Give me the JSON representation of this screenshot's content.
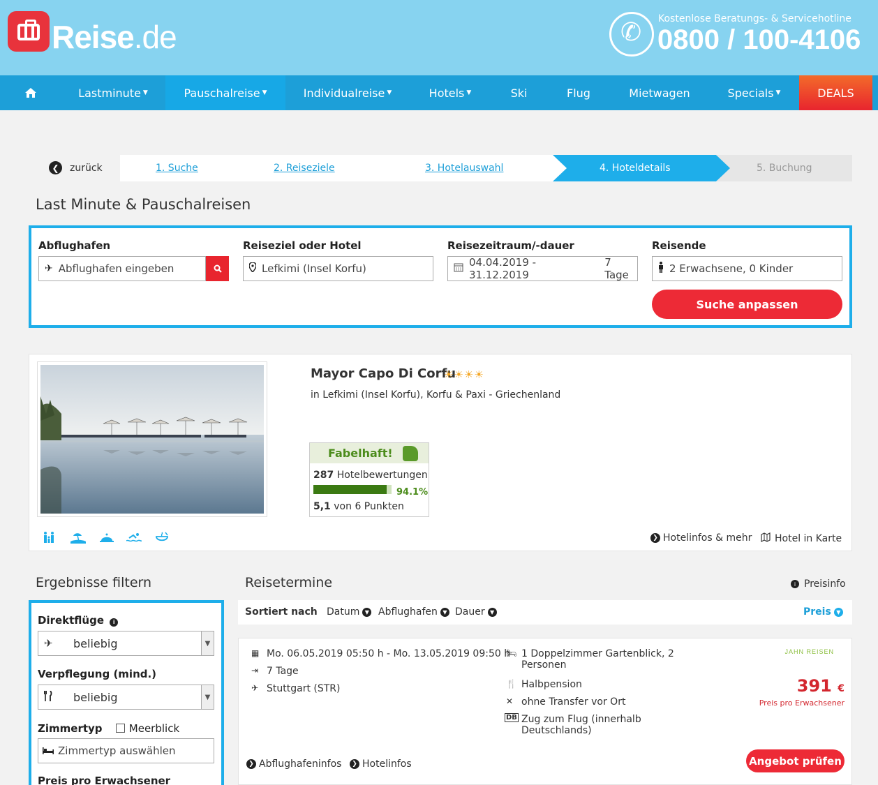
{
  "header": {
    "logo_main": "Reise",
    "logo_suffix": ".de",
    "hotline_label": "Kostenlose Beratungs- & Servicehotline",
    "hotline_number": "0800 / 100-4106"
  },
  "nav": {
    "items": [
      "Lastminute",
      "Pauschalreise",
      "Individualreise",
      "Hotels",
      "Ski",
      "Flug",
      "Mietwagen",
      "Specials",
      "DEALS"
    ]
  },
  "steps": {
    "back": "zurück",
    "s1": "1. Suche",
    "s2": "2. Reiseziele",
    "s3": "3. Hotelauswahl",
    "s4": "4. Hoteldetails",
    "s5": "5. Buchung"
  },
  "page_title": "Last Minute & Pauschalreisen",
  "search": {
    "airport_label": "Abflughafen",
    "airport_placeholder": "Abflughafen eingeben",
    "dest_label": "Reiseziel oder Hotel",
    "dest_value": "Lefkimi (Insel Korfu)",
    "period_label": "Reisezeitraum/-dauer",
    "period_value": "04.04.2019 - 31.12.2019",
    "duration_value": "7 Tage",
    "travellers_label": "Reisende",
    "travellers_value": "2 Erwachsene, 0 Kinder",
    "submit": "Suche anpassen"
  },
  "hotel": {
    "name": "Mayor Capo Di Corfu",
    "stars": "☀☀☀☀",
    "location": "in Lefkimi (Insel Korfu), Korfu & Paxi - Griechenland",
    "rating_label": "Fabelhaft!",
    "review_count": "287",
    "review_text": "Hotelbewertungen",
    "recommend_pct": "94.1%",
    "recommend_fraction": 0.941,
    "score": "5,1",
    "score_text": "von 6 Punkten",
    "link_info": "Hotelinfos & mehr",
    "link_map": "Hotel in Karte"
  },
  "filter": {
    "title": "Ergebnisse filtern",
    "direct_label": "Direktflüge",
    "direct_value": "beliebig",
    "board_label": "Verpflegung (mind.)",
    "board_value": "beliebig",
    "room_label": "Zimmertyp",
    "seaview": "Meerblick",
    "room_placeholder": "Zimmertyp auswählen",
    "price_label": "Preis pro Erwachsener (beliebig)"
  },
  "results": {
    "title": "Reisetermine",
    "preisinfo": "Preisinfo",
    "sorted_by": "Sortiert nach",
    "sort": [
      "Datum",
      "Abflughafen",
      "Dauer"
    ],
    "sort_active": "Preis"
  },
  "offer": {
    "dates": "Mo. 06.05.2019 05:50 h - Mo. 13.05.2019 09:50 h",
    "duration": "7 Tage",
    "airport": "Stuttgart (STR)",
    "room_line1": "1 Doppelzimmer Gartenblick, 2",
    "room_line2": "Personen",
    "board": "Halbpension",
    "transfer": "ohne Transfer vor Ort",
    "train_line1": "Zug zum Flug (innerhalb",
    "train_line2": "Deutschlands)",
    "operator": "JAHN REISEN",
    "price": "391",
    "currency": "€",
    "price_note": "Preis pro Erwachsener",
    "cta": "Angebot prüfen",
    "link_airport": "Abflughafeninfos",
    "link_hotel": "Hotelinfos"
  }
}
